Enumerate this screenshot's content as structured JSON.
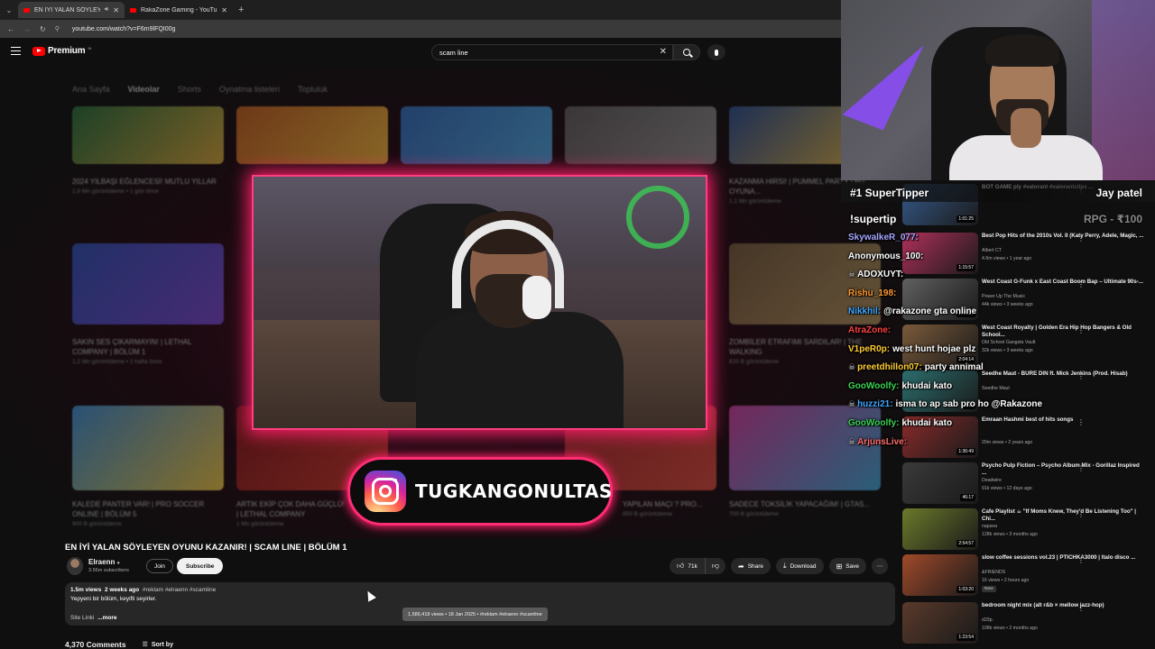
{
  "browser": {
    "tabs": [
      {
        "title": "EN İYİ YALAN SÖYLEYEN O...",
        "active": true
      },
      {
        "title": "RakaZone Gaming - YouTube",
        "active": false
      }
    ],
    "url": "youtube.com/watch?v=F6m9lFQI00g"
  },
  "header": {
    "logo_text": "Premium",
    "logo_superscript": "IN",
    "search_value": "scam line"
  },
  "channel_page": {
    "tabs": [
      "Ana Sayfa",
      "Videolar",
      "Shorts",
      "Oynatma listeleri",
      "Topluluk"
    ],
    "captions": [
      {
        "title": "2024 YILBAŞI EĞLENCESİ! MUTLU YILLAR",
        "meta": "1,9 Mn görüntüleme • 1 gün önce"
      },
      {
        "title": "KAZANMA HIRSI! | PUMMEL PARTY | BU OYUNA...",
        "meta": "1,1 Mn görüntüleme"
      },
      {
        "title": "SAKIN SES ÇIKARMAYIN! | LETHAL COMPANY | BÖLÜM 1",
        "meta": "1,2 Mn görüntüleme • 2 hafta önce"
      },
      {
        "title": "ZOMBİLER ETRAFIMI SARDILAR! | THE WALKING",
        "meta": "820 B görüntüleme"
      },
      {
        "title": "KALEDE PANTER VAR! | PRO SOCCER ONLINE | BÖLÜM 5",
        "meta": "900 B görüntüleme"
      },
      {
        "title": "ARTIK EKİP ÇOK DAHA GÜÇLÜ! | LETHAL COMPANY",
        "meta": "1 Mn görüntüleme"
      },
      {
        "title": "YAPILAN MAÇI ? PRO...",
        "meta": "650 B görüntüleme"
      },
      {
        "title": "SADECE TOKSİLİK YAPACAĞIM! | GTAS...",
        "meta": "700 B görüntüleme"
      }
    ]
  },
  "overlay": {
    "instagram_handle": "TUGKANGONULTAS"
  },
  "video": {
    "title": "EN İYİ YALAN SÖYLEYEN OYUNU KAZANIR! | SCAM LINE | BÖLÜM 1",
    "channel": "Elraenn",
    "subscribers": "3.56m subscribers",
    "join_label": "Join",
    "subscribe_label": "Subscribe",
    "likes": "71k",
    "share_label": "Share",
    "download_label": "Download",
    "save_label": "Save",
    "views": "1.5m views",
    "age": "2 weeks ago",
    "hashtags": "#reklam #elraenn #scamline",
    "description_line": "Yepyeni bir bölüm, keyifli seyirler.",
    "site_link": "Site Linki",
    "more_label": "...more",
    "tooltip": "1,586,418 views • 18 Jan 2025 • #reklam #elraenn #scamline",
    "comments_count": "4,370 Comments",
    "sort_label": "Sort by"
  },
  "stream_overlay": {
    "top_tipper_label": "#1 SuperTipper",
    "top_tipper_name": "Jay patel",
    "tip_command": "!supertip",
    "tip_amount": "RPG - ₹100"
  },
  "chat": [
    {
      "user": "SkywalkeR_077:",
      "text": "",
      "color": "#a6a6ff"
    },
    {
      "user": "Anonymous_100:",
      "text": "",
      "color": "#ffffff"
    },
    {
      "user": "ADOXUYT:",
      "text": "",
      "color": "#ffffff",
      "skull": true
    },
    {
      "user": "Rishu_198:",
      "text": "",
      "color": "#ff9933"
    },
    {
      "user": "Nikkhil:",
      "text": "@rakazone gta online",
      "color": "#3ea6ff"
    },
    {
      "user": "AtraZone:",
      "text": "",
      "color": "#ff4040"
    },
    {
      "user": "V1peR0p:",
      "text": "west hunt hojae plz",
      "color": "#ffcc33"
    },
    {
      "user": "preetdhillon07:",
      "text": "party annimal",
      "color": "#ffcc33",
      "skull": true
    },
    {
      "user": "GooWoolfy:",
      "text": "khudai kato",
      "color": "#39d353"
    },
    {
      "user": "huzzi21:",
      "text": "isma to ap sab pro ho @Rakazone",
      "color": "#3ea6ff",
      "skull": true
    },
    {
      "user": "GooWoolfy:",
      "text": "khudai kato",
      "color": "#39d353"
    },
    {
      "user": "ArjunsLive:",
      "text": "",
      "color": "#ff6b6b",
      "skull": true
    }
  ],
  "recommendations": [
    {
      "title": "BOT GAME ply #valorant #valorantclips ...",
      "channel": "",
      "meta": "",
      "duration": "1:01:25",
      "color": "#355a8a"
    },
    {
      "title": "Best Pop Hits of the 2010s Vol. II (Katy Perry, Adele, Magic, ...",
      "channel": "Albert CT",
      "meta": "4.6m views • 1 year ago",
      "duration": "1:15:57",
      "color": "#b0305c"
    },
    {
      "title": "West Coast G-Funk x East Coast Boom Bap – Ultimate 90s-...",
      "channel": "Power Up The Music",
      "meta": "44k views • 3 weeks ago",
      "duration": "3:13:37",
      "color": "#606060"
    },
    {
      "title": "West Coast Royalty | Golden Era Hip Hop Bangers & Old School...",
      "channel": "Old School Gangsta Vault",
      "meta": "32k views • 3 weeks ago",
      "duration": "2:04:14",
      "color": "#7a5a3a"
    },
    {
      "title": "Seedhe Maut - BURE DIN ft. Mick Jenkins (Prod. Hisab)",
      "channel": "Seedhe Maut",
      "meta": "",
      "duration": "3:14",
      "color": "#2c6e6e"
    },
    {
      "title": "Emraan Hashmi best of hits songs",
      "channel": "",
      "meta": "20m views • 2 years ago",
      "duration": "1:36:49",
      "color": "#8a2b2b"
    },
    {
      "title": "Psycho Pulp Fiction – Psycho Album Mix - Gorillaz Inspired ...",
      "channel": "Deadwire",
      "meta": "91k views • 12 days ago",
      "duration": "46:17",
      "color": "#3a3a3a"
    },
    {
      "title": "Cafe Playlist ☕ \"If Moms Knew, They'd Be Listening Too\" | Chi...",
      "channel": "napsea",
      "meta": "128k views • 3 months ago",
      "duration": "2:54:57",
      "color": "#6b7a2a"
    },
    {
      "title": "slow coffee sessions  vol.23 | PTICHKA3000 | Italo disco ...",
      "channel": "&FRIENDS",
      "meta": "16 views • 2 hours ago",
      "new": "New",
      "duration": "1:03:20",
      "color": "#a04a2a"
    },
    {
      "title": "bedroom night mix (alt r&b × mellow jazz-hop)",
      "channel": "d33p.",
      "meta": "108k views • 2 months ago",
      "duration": "1:23:54",
      "color": "#5a3a2a"
    }
  ]
}
